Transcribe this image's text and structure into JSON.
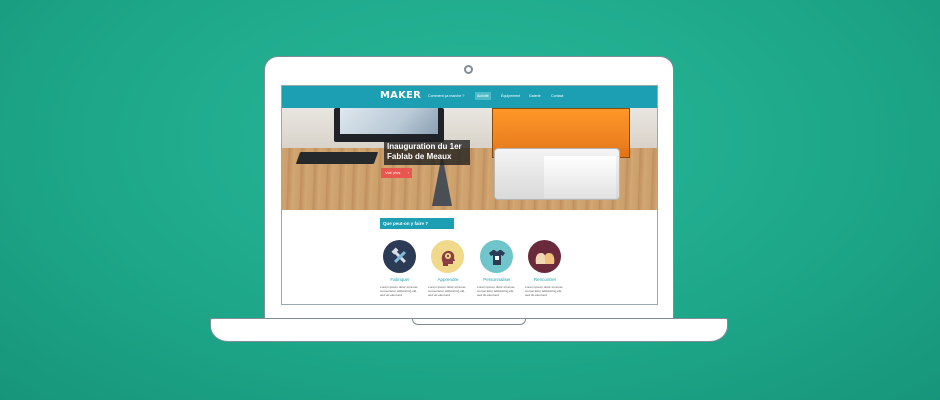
{
  "site": {
    "logo": "MAKER",
    "nav": [
      {
        "label": "Comment ça marche ?",
        "active": false
      },
      {
        "label": "Activité",
        "active": true
      },
      {
        "label": "Équipement",
        "active": false
      },
      {
        "label": "Galerie",
        "active": false
      },
      {
        "label": "Contact",
        "active": false
      }
    ]
  },
  "hero": {
    "title": "Inauguration du 1er Fablab de Meaux",
    "button_label": "Voir plus",
    "button_arrow": "›"
  },
  "section": {
    "title": "Que peut-on y faire ?",
    "features": [
      {
        "label": "Fabriquer",
        "icon": "tools-icon",
        "color": "#2b3a55",
        "text": "Lorem ipsum dolor sit amet, consectetur adipisicing elit, sed do eiusmod"
      },
      {
        "label": "Apprendre",
        "icon": "head-gears-icon",
        "color": "#f0d98a",
        "text": "Lorem ipsum dolor sit amet, consectetur adipisicing elit, sed do eiusmod"
      },
      {
        "label": "Personnaliser",
        "icon": "tshirt-icon",
        "color": "#6fc5c9",
        "text": "Lorem ipsum dolor sit amet, consectetur adipisicing elit, sed do eiusmod"
      },
      {
        "label": "Rencontrer",
        "icon": "people-talking-icon",
        "color": "#6b2a3c",
        "text": "Lorem ipsum dolor sit amet, consectetur adipisicing elit, sed do eiusmod"
      }
    ]
  },
  "colors": {
    "background": "#1ea889",
    "brand": "#1d9fb3",
    "cta": "#e8564f"
  }
}
